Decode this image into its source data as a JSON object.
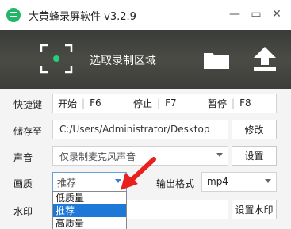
{
  "window": {
    "title": "大黄蜂录屏软件 v3.2.9",
    "controls": {
      "minimize": "—",
      "restore": "▭",
      "close": "✕"
    }
  },
  "header": {
    "capture_label": "选取录制区域",
    "icons": [
      "capture-region-icon",
      "folder-icon",
      "upload-icon"
    ]
  },
  "hotkeys": {
    "label": "快捷键",
    "items": [
      {
        "action": "开始",
        "key": "F6"
      },
      {
        "action": "停止",
        "key": "F7"
      },
      {
        "action": "暂停",
        "key": "F8"
      }
    ]
  },
  "save_to": {
    "label": "储存至",
    "path": "C:/Users/Administrator/Desktop",
    "button": "修改"
  },
  "audio": {
    "label": "声音",
    "value": "仅录制麦克风声音",
    "button": "设置"
  },
  "quality": {
    "label": "画质",
    "value": "推荐",
    "options": [
      "低质量",
      "推荐",
      "高质量"
    ],
    "selected_index": 1
  },
  "output_format": {
    "label": "输出格式",
    "value": "mp4"
  },
  "watermark": {
    "label": "水印",
    "button": "设置水印"
  },
  "colors": {
    "accent_green": "#25b56a",
    "selection_blue": "#1e78d7",
    "annotation_red": "#e8201e"
  }
}
